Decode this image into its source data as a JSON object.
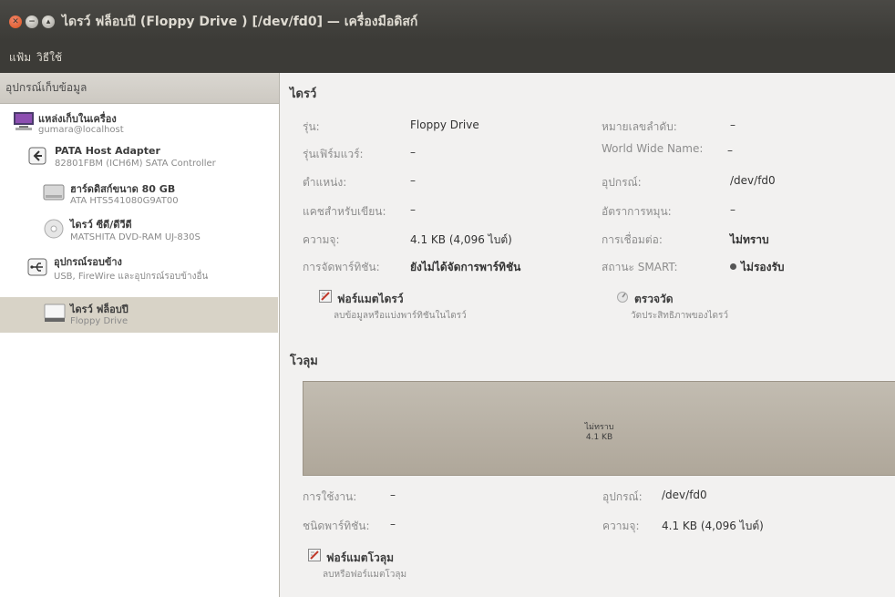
{
  "window": {
    "title": "ไดรว์ ฟล็อบปี (Floppy Drive ) [/dev/fd0] — เครื่องมือดิสก์",
    "close_glyph": "✕",
    "min_glyph": "−",
    "max_glyph": "▴"
  },
  "menu": {
    "file": "แฟ้ม",
    "help": "วิธีใช้"
  },
  "sidebar": {
    "header": "อุปกรณ์เก็บข้อมูล",
    "items": [
      {
        "title": "แหล่งเก็บในเครื่อง",
        "subtitle": "gumara@localhost",
        "icon": "computer-icon"
      },
      {
        "title": "PATA Host Adapter",
        "subtitle": "82801FBM (ICH6M) SATA Controller",
        "icon": "host-adapter-icon"
      },
      {
        "title": "ฮาร์ดดิสก์ขนาด 80 GB",
        "subtitle": "ATA HTS541080G9AT00",
        "icon": "hard-disk-icon"
      },
      {
        "title": "ไดรว์ ซีดี/ดีวีดี",
        "subtitle": "MATSHITA DVD-RAM UJ-830S",
        "icon": "optical-disc-icon"
      },
      {
        "title": "อุปกรณ์รอบข้าง",
        "subtitle": "USB, FireWire และอุปกรณ์รอบข้างอื่น",
        "icon": "usb-icon"
      },
      {
        "title": "ไดรว์ ฟล็อบปี",
        "subtitle": "Floppy Drive",
        "icon": "floppy-drive-icon",
        "selected": true
      }
    ]
  },
  "drive": {
    "section_title": "ไดรว์",
    "model_label": "รุ่น:",
    "model_value": "Floppy Drive",
    "firmware_label": "รุ่นเฟิร์มแวร์:",
    "firmware_value": "–",
    "location_label": "ตำแหน่ง:",
    "location_value": "–",
    "write_cache_label": "แคชสำหรับเขียน:",
    "write_cache_value": "–",
    "capacity_label": "ความจุ:",
    "capacity_value": "4.1 KB (4,096 ไบต์)",
    "partitioning_label": "การจัดพาร์ทิชัน:",
    "partitioning_value": "ยังไม่ได้จัดการพาร์ทิชัน",
    "serial_label": "หมายเลขลำดับ:",
    "serial_value": "–",
    "wwn_label": "World Wide Name:",
    "wwn_value": "–",
    "device_label": "อุปกรณ์:",
    "device_value": "/dev/fd0",
    "rotation_label": "อัตราการหมุน:",
    "rotation_value": "–",
    "connection_label": "การเชื่อมต่อ:",
    "connection_value": "ไม่ทราบ",
    "smart_label": "สถานะ SMART:",
    "smart_value": "ไม่รองรับ",
    "format_drive_title": "ฟอร์แมตไดรว์",
    "format_drive_sub": "ลบข้อมูลหรือแบ่งพาร์ทิชันในไดรว์",
    "benchmark_title": "ตรวจวัด",
    "benchmark_sub": "วัดประสิทธิภาพของไดรว์"
  },
  "volumes": {
    "section_title": "โวลุม",
    "bar_status": "ไม่ทราบ",
    "bar_size": "4.1 KB",
    "usage_label": "การใช้งาน:",
    "usage_value": "–",
    "partition_type_label": "ชนิดพาร์ทิชัน:",
    "partition_type_value": "–",
    "device_label": "อุปกรณ์:",
    "device_value": "/dev/fd0",
    "capacity_label": "ความจุ:",
    "capacity_value": "4.1 KB (4,096 ไบต์)",
    "format_volume_title": "ฟอร์แมตโวลุม",
    "format_volume_sub": "ลบหรือฟอร์แมตโวลุม"
  }
}
